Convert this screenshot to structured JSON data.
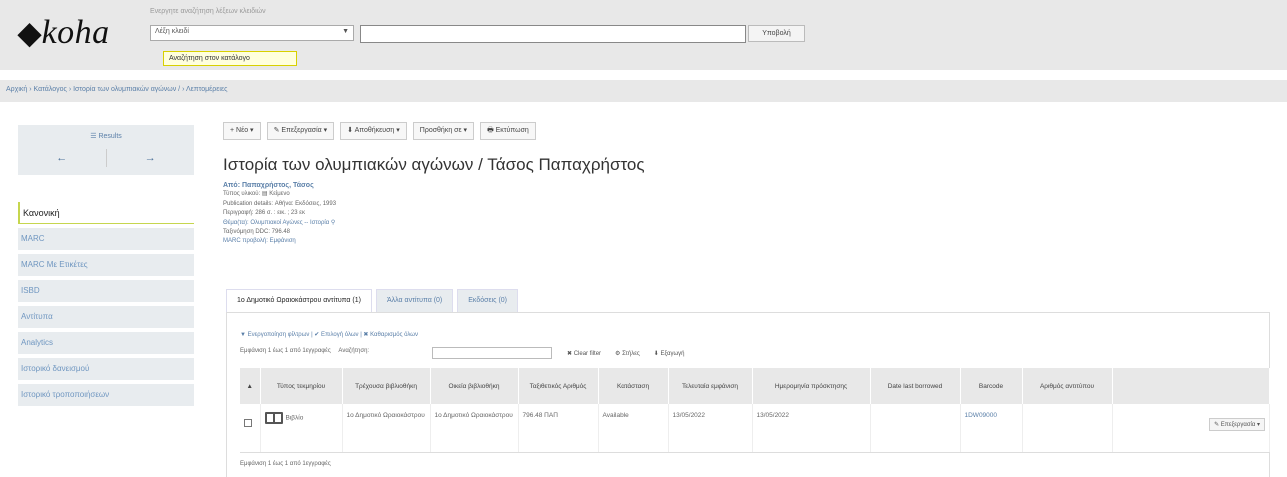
{
  "header": {
    "logo": "koha",
    "search_hint": "Ενεργητε αναζήτηση λέξεων κλειδιών",
    "search_type": "Λέξη κλειδί",
    "submit_label": "Υποβολή",
    "tooltip": "Αναζήτηση στον κατάλογο"
  },
  "breadcrumb": "Αρχική › Κατάλογος › Ιστορία των ολυμπιακών αγώνων / › Λεπτομέρειες",
  "sidebar": {
    "results_label": "☰ Results",
    "prev_arrow": "←",
    "next_arrow": "→",
    "items": [
      {
        "label": "Κανονική",
        "active": true
      },
      {
        "label": "MARC"
      },
      {
        "label": "MARC Με Ετικέτες"
      },
      {
        "label": "ISBD"
      },
      {
        "label": "Αντίτυπα"
      },
      {
        "label": "Analytics"
      },
      {
        "label": "Ιστορικό δανεισμού"
      },
      {
        "label": "Ιστορικό τροποποιήσεων"
      }
    ]
  },
  "toolbar": {
    "new": "+ Νέο ▾",
    "edit": "✎ Επεξεργασία ▾",
    "save": "⬇ Αποθήκευση ▾",
    "add_to": "Προσθήκη σε ▾",
    "print": "🖶 Εκτύπωση"
  },
  "record": {
    "title": "Ιστορία των ολυμπιακών αγώνων / Τάσος Παπαχρήστος",
    "author": "Από: Παπαχρήστος, Τάσος",
    "material_type": "Τύπος υλικού: ▤ Κείμενο",
    "publication": "Publication details: Αθήνα: Εκδόσεις, 1993",
    "description": "Περιγραφή: 286 σ. : εικ. ; 23 εκ",
    "subject": "Θέμα(τα): Ολυμπιακοί Αγώνες -- Ιστορία ⚲",
    "ddc": "Ταξινόμηση DDC: 796.48",
    "marc_view": "MARC προβολή: Εμφάνιση"
  },
  "tabs": [
    {
      "label": "1ο Δημοτικό Ωραιοκάστρου αντίτυπα (1)",
      "active": true
    },
    {
      "label": "Άλλα αντίτυπα (0)"
    },
    {
      "label": "Εκδόσεις (0)"
    }
  ],
  "items_actions": "▼ Ενεργοποίηση φίλτρων | ✔ Επιλογή όλων | ✖ Καθαρισμός όλων",
  "items_filter": {
    "count_text": "Εμφάνιση 1 έως 1 από 1εγγραφές",
    "search_label": "Αναζήτηση:",
    "clear": "✖ Clear filter",
    "columns": "⚙ Στήλες",
    "export": "⬇ Εξαγωγή"
  },
  "table": {
    "headers": [
      "Τύπος τεκμηρίου",
      "Τρέχουσα βιβλιοθήκη",
      "Οικεία βιβλιοθήκη",
      "Ταξιθετικός Αριθμός",
      "Κατάσταση",
      "Τελευταία εμφάνιση",
      "Ημερομηνία πρόσκτησης",
      "Date last borrowed",
      "Barcode",
      "Αριθμός αντιτύπου"
    ],
    "rows": [
      {
        "type": "Βιβλίο",
        "current_library": "1ο Δημοτικό Ωραιοκάστρου",
        "home_library": "1ο Δημοτικό Ωραιοκάστρου",
        "call_number": "796.48 ΠΑΠ",
        "status": "Available",
        "last_seen": "13/05/2022",
        "accession_date": "13/05/2022",
        "last_borrowed": "",
        "barcode": "1DW09000",
        "copy_number": "",
        "edit": "✎ Επεξεργασία ▾"
      }
    ]
  },
  "footer_count": "Εμφάνιση 1 έως 1 από 1εγγραφές"
}
